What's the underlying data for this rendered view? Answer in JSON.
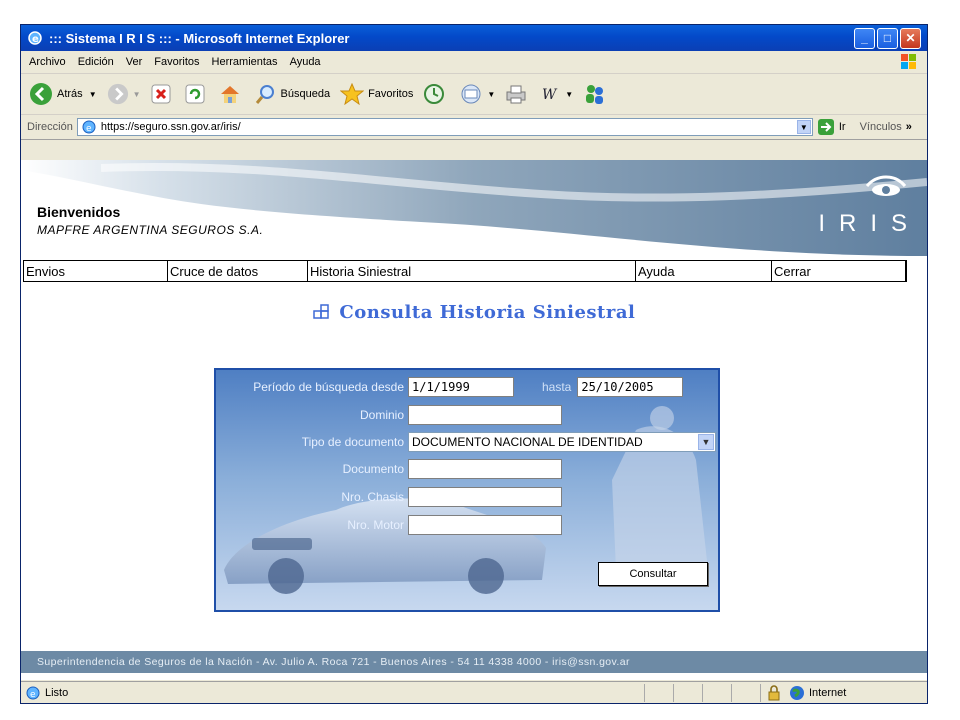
{
  "window": {
    "title": "::: Sistema I R I S ::: - Microsoft Internet Explorer"
  },
  "menu": [
    "Archivo",
    "Edición",
    "Ver",
    "Favoritos",
    "Herramientas",
    "Ayuda"
  ],
  "toolbar": {
    "back": "Atrás",
    "search": "Búsqueda",
    "favorites": "Favoritos"
  },
  "address": {
    "label": "Dirección",
    "url": "https://seguro.ssn.gov.ar/iris/",
    "go": "Ir",
    "links": "Vínculos"
  },
  "banner": {
    "welcome": "Bienvenidos",
    "company": "MAPFRE ARGENTINA SEGUROS S.A.",
    "logo": "IRIS"
  },
  "nav": [
    "Envios",
    "Cruce de datos",
    "Historia Siniestral",
    "Ayuda",
    "Cerrar"
  ],
  "page": {
    "title": "Consulta Historia Siniestral"
  },
  "form": {
    "period_label": "Período de búsqueda desde",
    "from": "1/1/1999",
    "until_label": "hasta",
    "to": "25/10/2005",
    "domain_label": "Dominio",
    "domain": "",
    "doc_type_label": "Tipo de documento",
    "doc_type": "DOCUMENTO NACIONAL DE IDENTIDAD",
    "document_label": "Documento",
    "document": "",
    "chassis_label": "Nro. Chasis",
    "chassis": "",
    "motor_label": "Nro. Motor",
    "motor": "",
    "submit": "Consultar"
  },
  "footer": {
    "text": "Superintendencia de Seguros de la Nación - Av. Julio A. Roca 721 - Buenos Aires - 54 11 4338 4000 - iris@ssn.gov.ar"
  },
  "status": {
    "text": "Listo",
    "zone": "Internet"
  }
}
